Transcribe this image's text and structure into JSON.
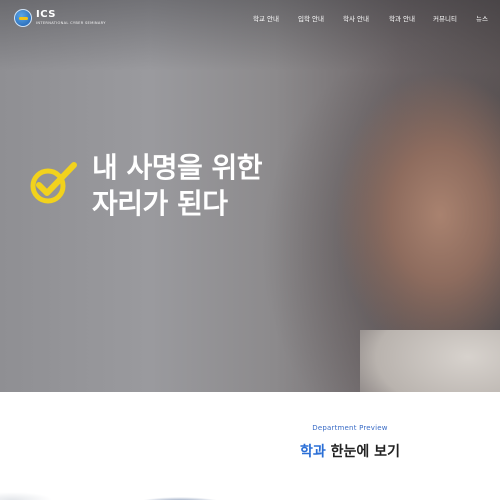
{
  "brand": {
    "name": "ICS",
    "tagline": "INTERNATIONAL CYBER SEMINARY"
  },
  "nav": {
    "items": [
      {
        "label": "학교 안내"
      },
      {
        "label": "입학 안내"
      },
      {
        "label": "학사 안내"
      },
      {
        "label": "학과 안내"
      },
      {
        "label": "커뮤니티"
      },
      {
        "label": "뉴스"
      }
    ]
  },
  "hero": {
    "headline_line1": "내 사명을 위한",
    "headline_line2": "자리가 된다",
    "check_color": "#f2d21c"
  },
  "preview": {
    "eyebrow": "Department Preview",
    "title_accent": "학과",
    "title_rest": " 한눈에 보기"
  }
}
